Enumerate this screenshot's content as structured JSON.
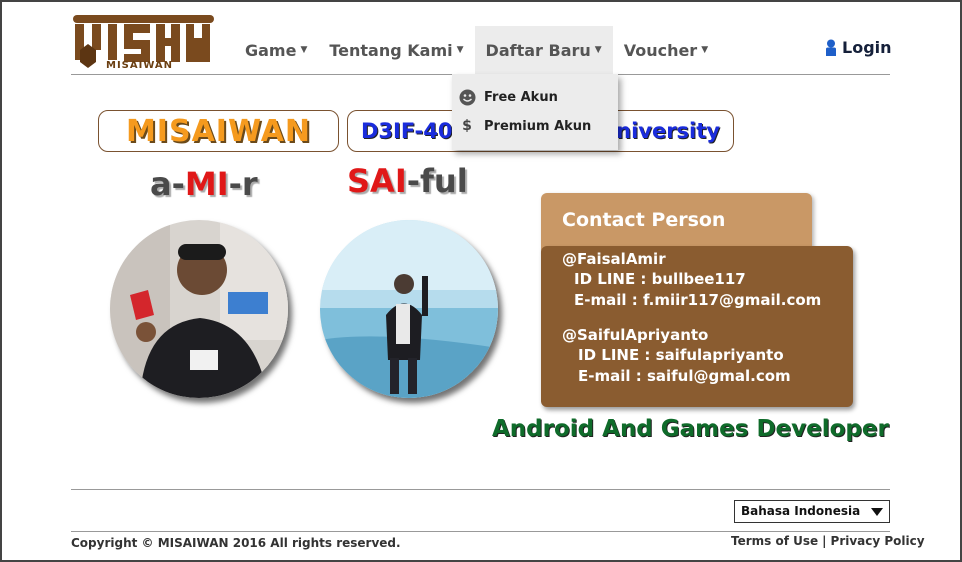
{
  "header": {
    "logo_text": "MISAIWAN",
    "nav": [
      {
        "label": "Game"
      },
      {
        "label": "Tentang Kami"
      },
      {
        "label": "Daftar Baru"
      },
      {
        "label": "Voucher"
      }
    ],
    "login_label": "Login"
  },
  "dropdown": {
    "items": [
      {
        "label": "Free Akun",
        "icon": "smiley-icon"
      },
      {
        "label": "Premium Akun",
        "icon": "dollar-icon",
        "glyph": "$"
      }
    ]
  },
  "banners": {
    "brand": "MISAIWAN",
    "left_visible": "D3IF-40",
    "right_visible": "niversity"
  },
  "people": [
    {
      "prefix": "a-",
      "highlight": "MI",
      "suffix": "-r"
    },
    {
      "prefix": "",
      "highlight": "SAI",
      "suffix": "-ful"
    }
  ],
  "contact": {
    "title": "Contact Person",
    "lines": [
      "@FaisalAmir",
      "ID LINE : bullbee117",
      "E-mail : f.miir117@gmail.com",
      "@SaifulApriyanto",
      "ID LINE : saifulapriyanto",
      "E-mail : saiful@gmal.com"
    ]
  },
  "tagline": "Android And Games Developer",
  "footer": {
    "language": "Bahasa Indonesia",
    "copyright": "Copyright © MISAIWAN 2016 All rights reserved.",
    "terms": "Terms of Use",
    "separator": "|",
    "privacy": "Privacy Policy"
  },
  "colors": {
    "brand_orange": "#f59a1e",
    "brand_brown": "#8a5c30",
    "contact_head": "#c99866",
    "highlight_red": "#e01818",
    "tagline_green": "#0f6b2a",
    "banner_blue": "#1a2cdc"
  }
}
